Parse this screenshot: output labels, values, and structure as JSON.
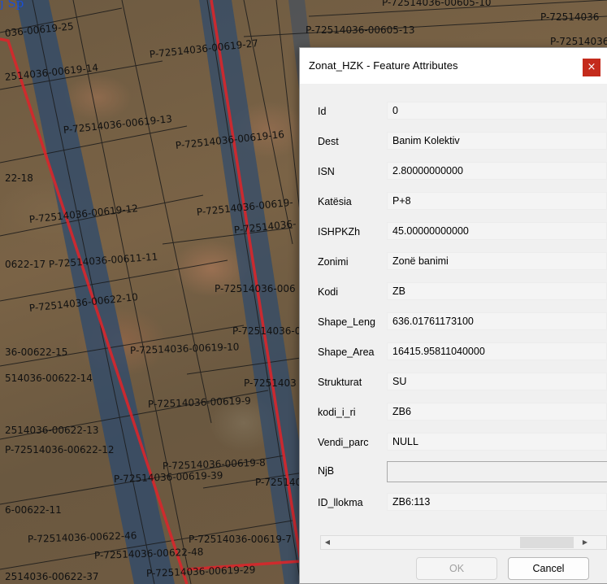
{
  "map": {
    "corner_label": "j Sp",
    "parcel_labels": [
      "P-72514036-00605-10",
      "P-72514036",
      "P-72514036-00605-13",
      "P-72514036-",
      "036-00619-25",
      "P-72514036-00619-27",
      "2514036-00619-14",
      "P-72514036-00619-13",
      "P-72514036-00619-16",
      "22-18",
      "P-72514036-00619-12",
      "P-72514036-00619-",
      "P-72514036-",
      "0622-17",
      "P-72514036-00611-11",
      "P-72514036-006",
      "P-72514036-00622-10",
      "P-72514036-0",
      "36-00622-15",
      "P-72514036-00619-10",
      "514036-00622-14",
      "P-7251403",
      "P-72514036-00619-9",
      "2514036-00622-13",
      "P-72514036-00622-12",
      "P-72514036-00619-8",
      "P-72514036-00619-39",
      "P-7251403",
      "6-00622-11",
      "P-72514036-00622-46",
      "P-72514036-00619-7",
      "P-72514036-00622-48",
      "P-72514036-00619-29",
      "2514036-00622-37"
    ]
  },
  "dialog": {
    "title": "Zonat_HZK - Feature Attributes",
    "close_label": "×",
    "attributes": [
      {
        "name": "Id",
        "value": "0"
      },
      {
        "name": "Dest",
        "value": "Banim Kolektiv"
      },
      {
        "name": "ISN",
        "value": "2.80000000000"
      },
      {
        "name": "Katësia",
        "value": "P+8"
      },
      {
        "name": "ISHPKZh",
        "value": "45.00000000000"
      },
      {
        "name": "Zonimi",
        "value": "Zonë banimi"
      },
      {
        "name": "Kodi",
        "value": "ZB"
      },
      {
        "name": "Shape_Leng",
        "value": "636.01761173100"
      },
      {
        "name": "Shape_Area",
        "value": "16415.95811040000"
      },
      {
        "name": "Strukturat",
        "value": "SU"
      },
      {
        "name": "kodi_i_ri",
        "value": "ZB6"
      },
      {
        "name": "Vendi_parc",
        "value": "NULL"
      },
      {
        "name": "NjB",
        "value": ""
      },
      {
        "name": "ID_llokma",
        "value": "ZB6:113"
      }
    ],
    "scroll_left_glyph": "◀",
    "scroll_right_glyph": "▶",
    "ok_label": "OK",
    "cancel_label": "Cancel"
  }
}
